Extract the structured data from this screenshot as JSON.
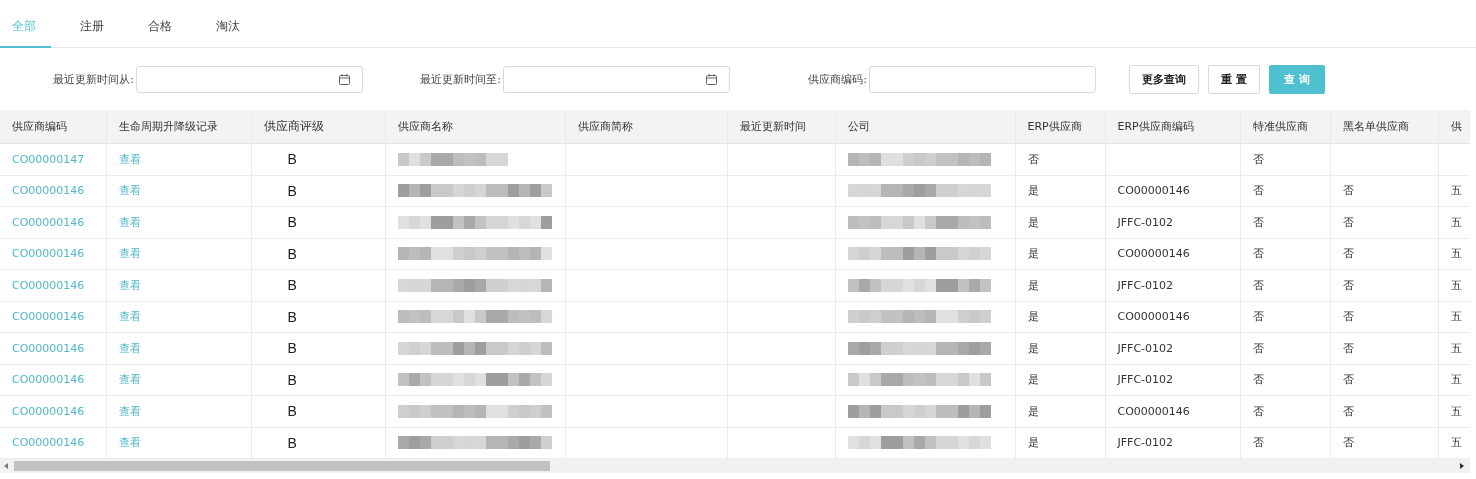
{
  "tabs": [
    {
      "label": "全部",
      "selected": true
    },
    {
      "label": "注册",
      "selected": false
    },
    {
      "label": "合格",
      "selected": false
    },
    {
      "label": "淘汰",
      "selected": false
    }
  ],
  "filters": [
    {
      "label": "最近更新时间从:",
      "kind": "date"
    },
    {
      "label": "最近更新时间至:",
      "kind": "date"
    },
    {
      "label": "供应商编码:",
      "kind": "text"
    }
  ],
  "buttons": [
    {
      "label": "更多查询",
      "primary": false
    },
    {
      "label": "重 置",
      "primary": false
    },
    {
      "label": "查 询",
      "primary": true
    }
  ],
  "table": {
    "columns": [
      "供应商编码",
      "生命周期升降级记录",
      "供应商评级",
      "供应商名称",
      "供应商简称",
      "最近更新时间",
      "公司",
      "ERP供应商",
      "ERP供应商编码",
      "特准供应商",
      "黑名单供应商",
      "供"
    ],
    "rows": [
      {
        "code": "CO00000147",
        "record": "查看",
        "rating": "B",
        "name_redacted": true,
        "short": "",
        "updated": "",
        "company_redacted": true,
        "erp": "否",
        "erp_code": "",
        "special": "否",
        "blacklist": "",
        "column_12": ""
      },
      {
        "code": "CO00000146",
        "record": "查看",
        "rating": "B",
        "name_redacted": true,
        "short": "",
        "updated": "",
        "company_redacted": true,
        "erp": "是",
        "erp_code": "CO00000146",
        "special": "否",
        "blacklist": "否",
        "column_12": "五"
      },
      {
        "code": "CO00000146",
        "record": "查看",
        "rating": "B",
        "name_redacted": true,
        "short": "",
        "updated": "",
        "company_redacted": true,
        "erp": "是",
        "erp_code": "JFFC-0102",
        "special": "否",
        "blacklist": "否",
        "column_12": "五"
      },
      {
        "code": "CO00000146",
        "record": "查看",
        "rating": "B",
        "name_redacted": true,
        "short": "",
        "updated": "",
        "company_redacted": true,
        "erp": "是",
        "erp_code": "CO00000146",
        "special": "否",
        "blacklist": "否",
        "column_12": "五"
      },
      {
        "code": "CO00000146",
        "record": "查看",
        "rating": "B",
        "name_redacted": true,
        "short": "",
        "updated": "",
        "company_redacted": true,
        "erp": "是",
        "erp_code": "JFFC-0102",
        "special": "否",
        "blacklist": "否",
        "column_12": "五"
      },
      {
        "code": "CO00000146",
        "record": "查看",
        "rating": "B",
        "name_redacted": true,
        "short": "",
        "updated": "",
        "company_redacted": true,
        "erp": "是",
        "erp_code": "CO00000146",
        "special": "否",
        "blacklist": "否",
        "column_12": "五"
      },
      {
        "code": "CO00000146",
        "record": "查看",
        "rating": "B",
        "name_redacted": true,
        "short": "",
        "updated": "",
        "company_redacted": true,
        "erp": "是",
        "erp_code": "JFFC-0102",
        "special": "否",
        "blacklist": "否",
        "column_12": "五"
      },
      {
        "code": "CO00000146",
        "record": "查看",
        "rating": "B",
        "name_redacted": true,
        "short": "",
        "updated": "",
        "company_redacted": true,
        "erp": "是",
        "erp_code": "JFFC-0102",
        "special": "否",
        "blacklist": "否",
        "column_12": "五"
      },
      {
        "code": "CO00000146",
        "record": "查看",
        "rating": "B",
        "name_redacted": true,
        "short": "",
        "updated": "",
        "company_redacted": true,
        "erp": "是",
        "erp_code": "CO00000146",
        "special": "否",
        "blacklist": "否",
        "column_12": "五"
      },
      {
        "code": "CO00000146",
        "record": "查看",
        "rating": "B",
        "name_redacted": true,
        "short": "",
        "updated": "",
        "company_redacted": true,
        "erp": "是",
        "erp_code": "JFFC-0102",
        "special": "否",
        "blacklist": "否",
        "column_12": "五"
      }
    ]
  }
}
